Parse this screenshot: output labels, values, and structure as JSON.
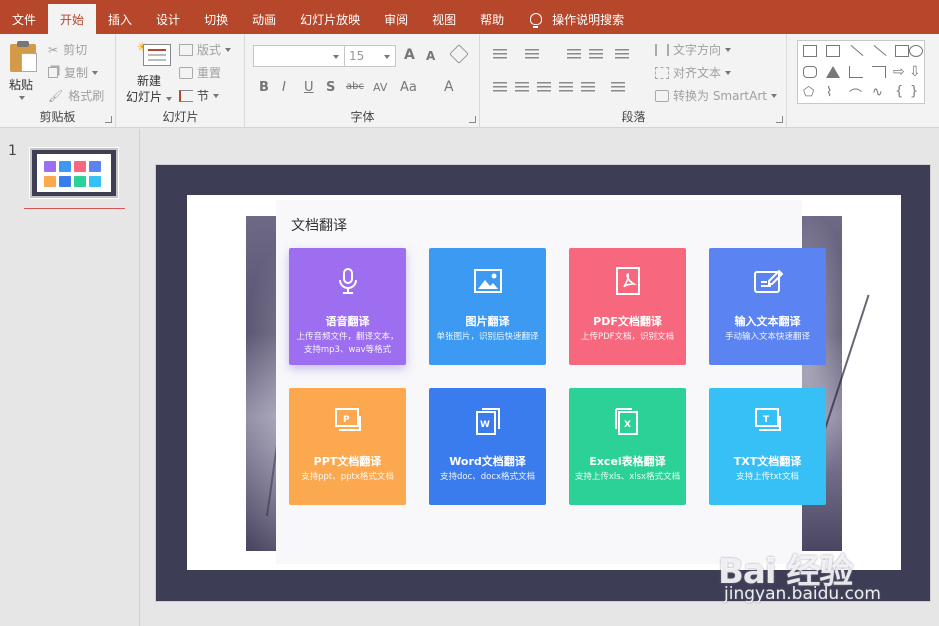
{
  "tabs": [
    {
      "label": "文件"
    },
    {
      "label": "开始",
      "active": true
    },
    {
      "label": "插入"
    },
    {
      "label": "设计"
    },
    {
      "label": "切换"
    },
    {
      "label": "动画"
    },
    {
      "label": "幻灯片放映"
    },
    {
      "label": "审阅"
    },
    {
      "label": "视图"
    },
    {
      "label": "帮助"
    }
  ],
  "search_label": "操作说明搜索",
  "ribbon": {
    "clipboard": {
      "paste": "粘贴",
      "cut": "剪切",
      "copy": "复制",
      "format_painter": "格式刷",
      "label": "剪贴板"
    },
    "slides": {
      "new_slide_line1": "新建",
      "new_slide_line2": "幻灯片",
      "layout": "版式",
      "reset": "重置",
      "section": "节",
      "label": "幻灯片"
    },
    "font": {
      "font_name": "",
      "font_size": "15",
      "bold": "B",
      "italic": "I",
      "underline": "U",
      "shadow": "S",
      "strike": "abc",
      "spacing": "AV",
      "case": "Aa",
      "color": "A",
      "grow": "A",
      "shrink": "A",
      "label": "字体"
    },
    "paragraph": {
      "text_direction": "文字方向",
      "align_text": "对齐文本",
      "smartart": "转换为 SmartArt",
      "label": "段落"
    }
  },
  "thumbnail": {
    "number": "1"
  },
  "slide": {
    "panel_title": "文档翻译",
    "cards": [
      {
        "title": "语音翻译",
        "desc": "上传音频文件，翻译文本，支持mp3、wav等格式",
        "color": "#9d6ef0",
        "icon": "microphone-icon"
      },
      {
        "title": "图片翻译",
        "desc": "单张图片，识别后快速翻译",
        "color": "#3c9af2",
        "icon": "image-icon"
      },
      {
        "title": "PDF文档翻译",
        "desc": "上传PDF文档，识别文档",
        "color": "#f7677e",
        "icon": "pdf-icon"
      },
      {
        "title": "输入文本翻译",
        "desc": "手动输入文本快速翻译",
        "color": "#5b84f2",
        "icon": "edit-text-icon"
      },
      {
        "title": "PPT文档翻译",
        "desc": "支持ppt、pptx格式文档",
        "color": "#fba84e",
        "icon": "ppt-icon"
      },
      {
        "title": "Word文档翻译",
        "desc": "支持doc、docx格式文档",
        "color": "#3a7bed",
        "icon": "word-icon"
      },
      {
        "title": "Excel表格翻译",
        "desc": "支持上传xls、xlsx格式文档",
        "color": "#2bd196",
        "icon": "excel-icon"
      },
      {
        "title": "TXT文档翻译",
        "desc": "支持上传txt文档",
        "color": "#37c0f5",
        "icon": "txt-icon"
      }
    ]
  },
  "watermark": {
    "main": "Bai 经验",
    "sub": "jingyan.baidu.com"
  }
}
